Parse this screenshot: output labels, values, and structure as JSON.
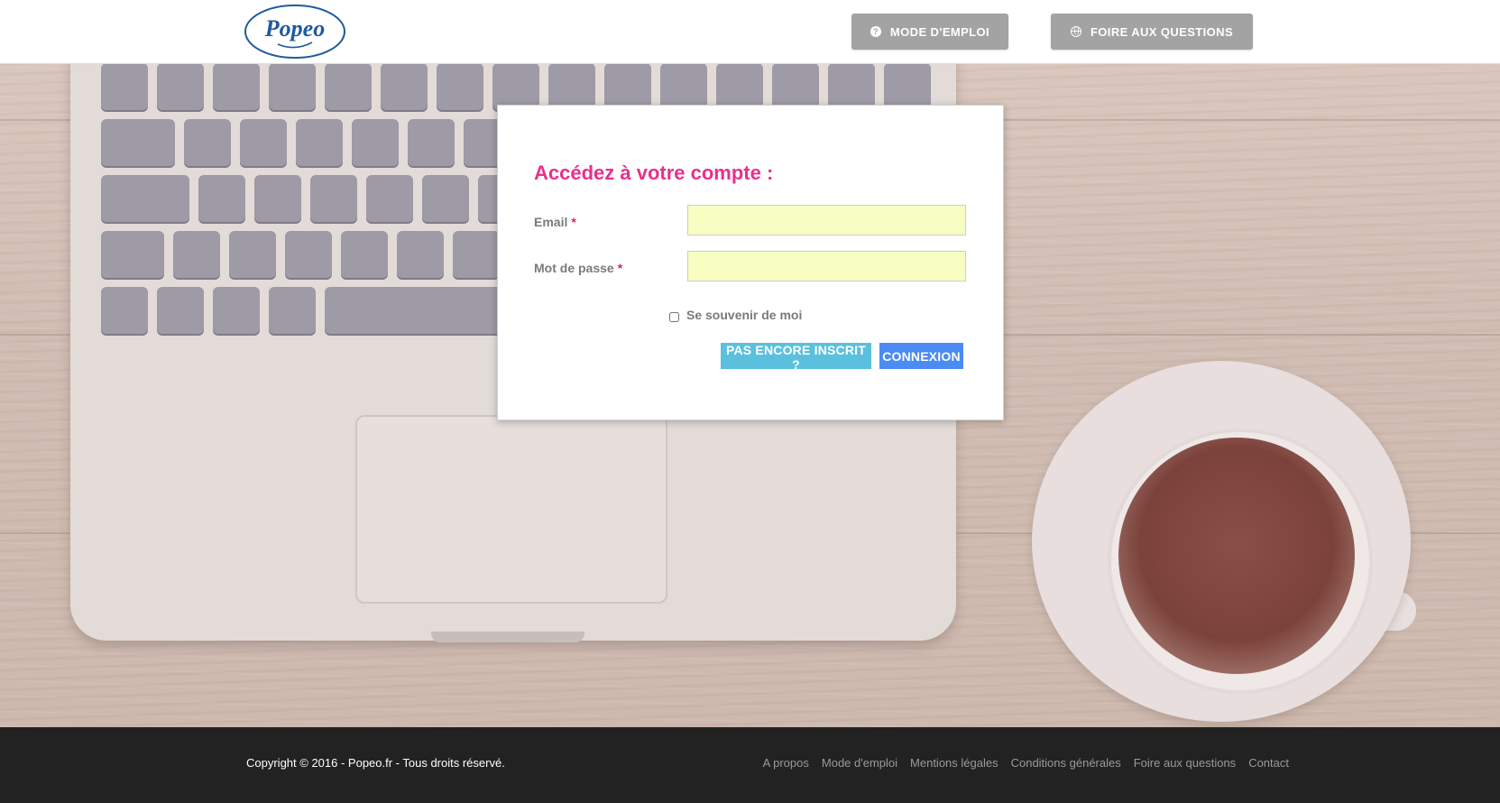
{
  "header": {
    "logo_text": "Popeo",
    "nav": [
      {
        "label": "MODE D'EMPLOI",
        "icon": "question-circle-icon"
      },
      {
        "label": "FOIRE AUX QUESTIONS",
        "icon": "globe-icon"
      }
    ]
  },
  "login": {
    "title": "Accédez à votre compte :",
    "email_label": "Email",
    "password_label": "Mot de passe",
    "required_mark": "*",
    "email_value": "",
    "password_value": "",
    "remember_label": "Se souvenir de moi",
    "remember_checked": false,
    "register_button": "PAS ENCORE INSCRIT ?",
    "login_button": "CONNEXION"
  },
  "footer": {
    "copyright": "Copyright © 2016 - Popeo.fr - Tous droits réservé.",
    "links": [
      "A propos",
      "Mode d'emploi",
      "Mentions légales",
      "Conditions générales",
      "Foire aux questions",
      "Contact"
    ]
  },
  "colors": {
    "title_pink": "#ea2f8a",
    "input_bg": "#f8fdc1",
    "register_btn": "#5bc0de",
    "login_btn": "#4b8bf4",
    "nav_btn": "#a3a3a3",
    "footer_bg": "#222222"
  }
}
